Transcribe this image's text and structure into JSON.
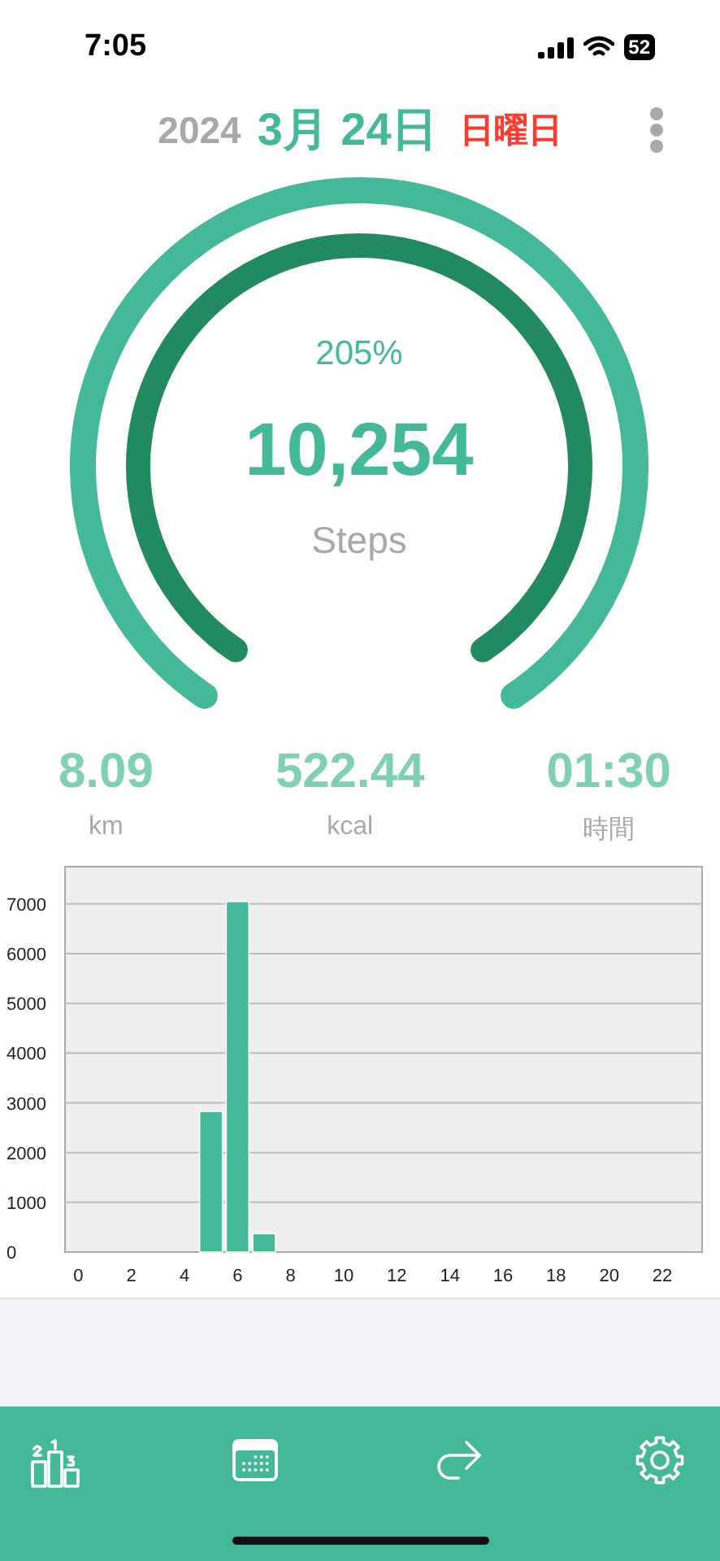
{
  "status_bar": {
    "time": "7:05",
    "battery": "52"
  },
  "header": {
    "year": "2024",
    "date": "3月 24日",
    "weekday": "日曜日"
  },
  "gauge": {
    "percent": "205%",
    "steps": "10,254",
    "unit": "Steps"
  },
  "stats": [
    {
      "value": "8.09",
      "label": "km"
    },
    {
      "value": "522.44",
      "label": "kcal"
    },
    {
      "value": "01:30",
      "label": "時間"
    }
  ],
  "chart_data": {
    "type": "bar",
    "grid": true,
    "x": [
      5,
      6,
      7
    ],
    "values": [
      2830,
      7050,
      370
    ],
    "xlim": [
      -0.5,
      23.5
    ],
    "ylim": [
      0,
      7750
    ],
    "xticks": [
      0,
      2,
      4,
      6,
      8,
      10,
      12,
      14,
      16,
      18,
      20,
      22
    ],
    "yticks": [
      0,
      1000,
      2000,
      3000,
      4000,
      5000,
      6000,
      7000
    ]
  },
  "tab_bar": {
    "items": [
      {
        "kind": "ranking"
      },
      {
        "kind": "calendar"
      },
      {
        "kind": "share"
      },
      {
        "kind": "settings"
      }
    ]
  }
}
